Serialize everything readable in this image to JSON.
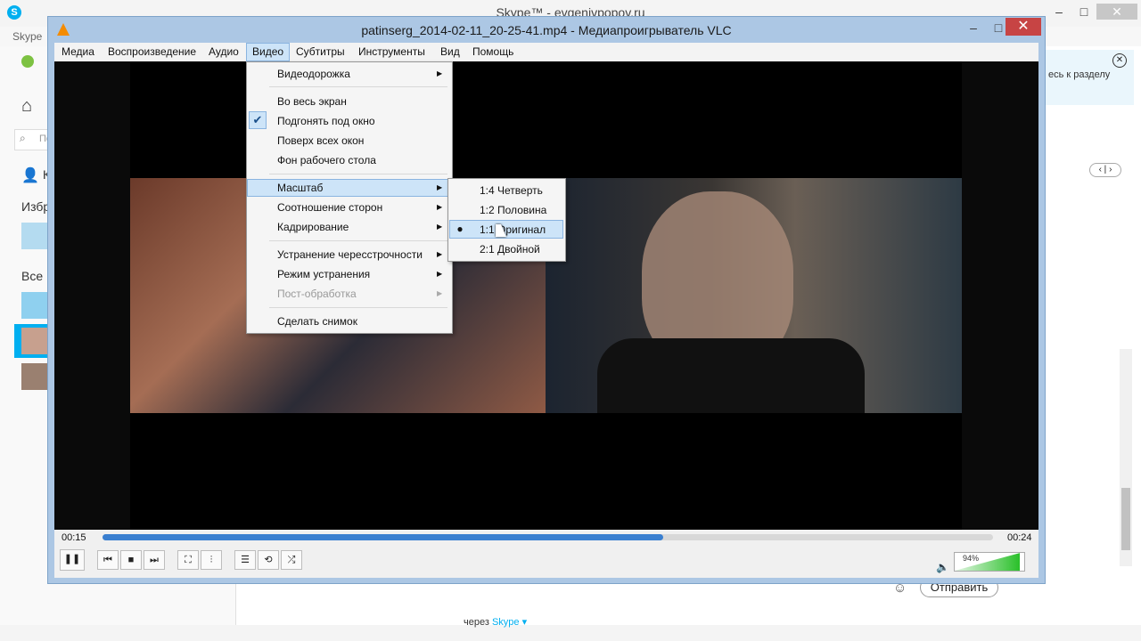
{
  "skype": {
    "window_title": "Skype™ - evgenivpopov.ru",
    "menu_label": "Skype",
    "window_controls": {
      "minimize": "–",
      "maximize": "□",
      "close": "✕"
    },
    "search_placeholder": "По",
    "contacts_label": "К",
    "favorites_label": "Избр",
    "all_label": "Все",
    "notification_text": "есь к разделу",
    "notification_close": "✕",
    "pager": "‹ | ›",
    "send_button": "Отправить",
    "via_text": "через ",
    "via_link": "Skype ▾"
  },
  "vlc": {
    "window_title": "patinserg_2014-02-11_20-25-41.mp4 - Медиапроигрыватель VLC",
    "window_controls": {
      "minimize": "–",
      "maximize": "□",
      "close": "✕"
    },
    "menu": [
      {
        "label": "Медиа"
      },
      {
        "label": "Воспроизведение"
      },
      {
        "label": "Аудио"
      },
      {
        "label": "Видео"
      },
      {
        "label": "Субтитры"
      },
      {
        "label": "Инструменты"
      },
      {
        "label": "Вид"
      },
      {
        "label": "Помощь"
      }
    ],
    "video_menu": {
      "items": [
        {
          "label": "Видеодорожка",
          "submenu": true
        },
        {
          "label": "Во весь экран"
        },
        {
          "label": "Подгонять под окно",
          "checked": true
        },
        {
          "label": "Поверх всех окон"
        },
        {
          "label": "Фон рабочего стола"
        },
        {
          "label": "Масштаб",
          "submenu": true,
          "highlighted": true
        },
        {
          "label": "Соотношение сторон",
          "submenu": true
        },
        {
          "label": "Кадрирование",
          "submenu": true
        },
        {
          "label": "Устранение чересстрочности",
          "submenu": true
        },
        {
          "label": "Режим устранения",
          "submenu": true
        },
        {
          "label": "Пост-обработка",
          "submenu": true,
          "disabled": true
        },
        {
          "label": "Сделать снимок"
        }
      ],
      "check_glyph": "✔",
      "arrow_glyph": "▶"
    },
    "zoom_submenu": {
      "items": [
        {
          "label": "1:4 Четверть"
        },
        {
          "label": "1:2 Половина"
        },
        {
          "label": "1:1 Оригинал",
          "selected": true
        },
        {
          "label": "2:1 Двойной"
        }
      ],
      "bullet_glyph": "●"
    },
    "playback": {
      "elapsed": "00:15",
      "total": "00:24",
      "progress": 0.63,
      "volume_label": "94%",
      "volume": 0.94,
      "accent_color": "#3a7fd0",
      "volume_color": "#29c029"
    },
    "controls": {
      "play_pause": "❚❚",
      "prev": "⏮",
      "stop": "■",
      "next": "⏭",
      "fullscreen": "⛶",
      "extended": "⫶",
      "playlist": "☰",
      "loop": "⟲",
      "shuffle": "⤮",
      "volume_icon": "🔈"
    }
  }
}
